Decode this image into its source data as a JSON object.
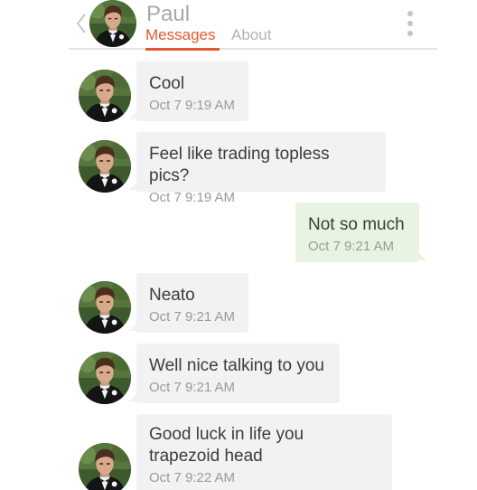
{
  "header": {
    "contact_name": "Paul",
    "tabs": [
      {
        "label": "Messages",
        "active": true
      },
      {
        "label": "About",
        "active": false
      }
    ]
  },
  "colors": {
    "accent": "#e3592f",
    "incoming_bubble": "#f2f2f2",
    "outgoing_bubble": "#e8f4e1"
  },
  "messages": [
    {
      "direction": "incoming",
      "text": "Cool",
      "time": "Oct 7 9:19 AM"
    },
    {
      "direction": "incoming",
      "text": "Feel like trading topless pics?",
      "time": "Oct 7 9:19 AM"
    },
    {
      "direction": "outgoing",
      "text": "Not so much",
      "time": "Oct 7 9:21 AM"
    },
    {
      "direction": "incoming",
      "text": "Neato",
      "time": "Oct 7 9:21 AM"
    },
    {
      "direction": "incoming",
      "text": "Well nice talking to you",
      "time": "Oct 7 9:21 AM"
    },
    {
      "direction": "incoming",
      "text": "Good luck in life you trapezoid head",
      "time": "Oct 7 9:22 AM"
    }
  ]
}
